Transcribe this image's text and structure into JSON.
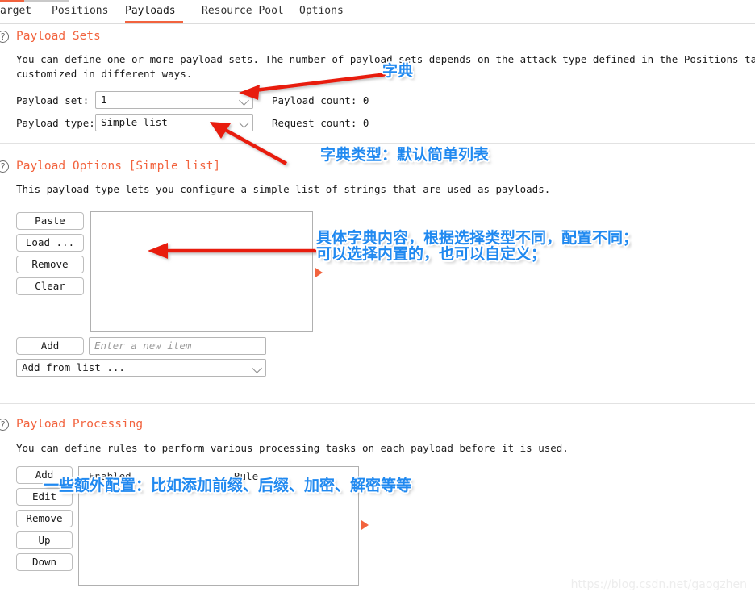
{
  "tabs": [
    {
      "label": "arget",
      "active": false
    },
    {
      "label": "Positions",
      "active": false
    },
    {
      "label": "Payloads",
      "active": true
    },
    {
      "label": "Resource Pool",
      "active": false
    },
    {
      "label": "Options",
      "active": false
    }
  ],
  "payload_sets": {
    "title": "Payload Sets",
    "help_icon": "question-mark-icon",
    "description_line1": "You can define one or more payload sets. The number of payload sets depends on the attack type defined in the Positions tab. Variou",
    "description_line2": "customized in different ways.",
    "payload_set_label": "Payload set:",
    "payload_set_value": "1",
    "payload_type_label": "Payload type:",
    "payload_type_value": "Simple list",
    "payload_count_label": "Payload count: 0",
    "request_count_label": "Request count: 0"
  },
  "payload_options": {
    "title": "Payload Options [Simple list]",
    "help_icon": "question-mark-icon",
    "description": "This payload type lets you configure a simple list of strings that are used as payloads.",
    "buttons": [
      "Paste",
      "Load ...",
      "Remove",
      "Clear"
    ],
    "add_button": "Add",
    "new_item_placeholder": "Enter a new item",
    "add_from_list": "Add from list ...",
    "list_items": []
  },
  "payload_processing": {
    "title": "Payload Processing",
    "help_icon": "question-mark-icon",
    "description": "You can define rules to perform various processing tasks on each payload before it is used.",
    "buttons": [
      "Add",
      "Edit",
      "Remove",
      "Up",
      "Down"
    ],
    "columns": [
      "Enabled",
      "Rule"
    ],
    "rows": []
  },
  "annotations": [
    {
      "text": "字典",
      "name": "annotation-dictionary"
    },
    {
      "text": "字典类型：默认简单列表",
      "name": "annotation-dictionary-type"
    },
    {
      "text": "具体字典内容，根据选择类型不同，配置不同；",
      "name": "annotation-dictionary-content-line1"
    },
    {
      "text": "可以选择内置的，也可以自定义；",
      "name": "annotation-dictionary-content-line2"
    },
    {
      "text": "一些额外配置：比如添加前缀、后缀、加密、解密等等",
      "name": "annotation-extra-config"
    }
  ],
  "watermark": "https://blog.csdn.net/gaogzhen",
  "colors": {
    "accent_orange": "#f2633e",
    "annotation_blue": "#2089f0",
    "arrow_red": "#e81b0b"
  }
}
